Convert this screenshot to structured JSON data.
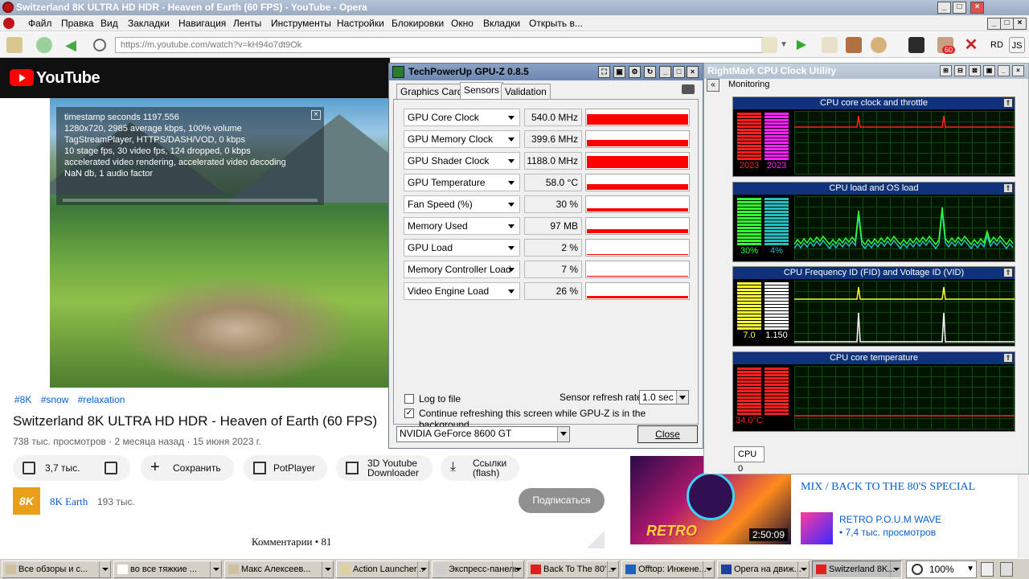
{
  "window": {
    "title": "Switzerland 8K ULTRA HD HDR - Heaven of Earth (60 FPS) - YouTube - Opera"
  },
  "menu": [
    "Файл",
    "Правка",
    "Вид",
    "Закладки",
    "Навигация",
    "Ленты",
    "Инструменты",
    "Настройки",
    "Блокировки",
    "Окно",
    "Вкладки",
    "Открыть в..."
  ],
  "address": {
    "url": "https://m.youtube.com/watch?v=kH94o7dt9Ok",
    "badge": "60",
    "btn_rd": "RD",
    "btn_js": "JS"
  },
  "youtube": {
    "logo": "YouTube",
    "stats": [
      "timestamp seconds 1197.556",
      "1280x720, 2985 average kbps, 100% volume",
      "TagStreamPlayer, HTTPS/DASH/VOD, 0 kbps",
      "10 stage fps, 30 video fps, 124 dropped, 0 kbps",
      "accelerated video rendering, accelerated video decoding",
      "NaN db, 1 audio factor"
    ],
    "tags": [
      "#8K",
      "#snow",
      "#relaxation"
    ],
    "title": "Switzerland 8K ULTRA HD HDR - Heaven of Earth (60 FPS)",
    "meta": "738 тыс. просмотров · 2 месяца назад · 15 июня 2023 г.",
    "likes": "3,7 тыс.",
    "save": "Сохранить",
    "potplayer": "PotPlayer",
    "downloader_line1": "3D Youtube",
    "downloader_line2": "Downloader",
    "links_line1": "Ссылки",
    "links_line2": "(flash)",
    "channel_logo": "8K",
    "channel_name": "8K Earth",
    "channel_subs": "193 тыс.",
    "subscribe": "Подписаться",
    "comments": "Комментарии  • 81",
    "reco_title": "MIX / BACK TO THE 80'S SPECIAL",
    "reco_duration": "2:50:09",
    "reco_thumb_text": "RETRO",
    "reco_channel": "RETRO P.O.U.M WAVE",
    "reco_views": "• 7,4 тыс. просмотров"
  },
  "gpuz": {
    "title": "TechPowerUp GPU-Z 0.8.5",
    "tabs": [
      "Graphics Card",
      "Sensors",
      "Validation"
    ],
    "active_tab": "Sensors",
    "sensors": [
      {
        "label": "GPU Core Clock",
        "value": "540.0 MHz",
        "level": 0.72
      },
      {
        "label": "GPU Memory Clock",
        "value": "399.6 MHz",
        "level": 0.45
      },
      {
        "label": "GPU Shader Clock",
        "value": "1188.0 MHz",
        "level": 0.85
      },
      {
        "label": "GPU Temperature",
        "value": "58.0 °C",
        "level": 0.4
      },
      {
        "label": "Fan Speed (%)",
        "value": "30 %",
        "level": 0.22
      },
      {
        "label": "Memory Used",
        "value": "97 MB",
        "level": 0.25
      },
      {
        "label": "GPU Load",
        "value": "2 %",
        "level": 0.03
      },
      {
        "label": "Memory Controller Load",
        "value": "7 %",
        "level": 0.05
      },
      {
        "label": "Video Engine Load",
        "value": "26 %",
        "level": 0.15
      }
    ],
    "log_to_file": "Log to file",
    "refresh_label": "Sensor refresh rate:",
    "refresh_value": "1.0 sec",
    "continue_label": "Continue refreshing this screen while GPU-Z is in the background",
    "gpu_select": "NVIDIA GeForce 8600 GT",
    "close": "Close"
  },
  "rmcu": {
    "title": "RightMark CPU Clock Utility",
    "group": "Monitoring",
    "panels": [
      {
        "title": "CPU core clock and throttle",
        "v1": "2023",
        "v2": "2023",
        "c1": "#ff2020",
        "c2": "#ff20ff"
      },
      {
        "title": "CPU load and OS load",
        "v1": "30%",
        "v2": "4%",
        "c1": "#30ff30",
        "c2": "#20c0c0"
      },
      {
        "title": "CPU Frequency ID (FID) and Voltage ID (VID)",
        "v1": "7.0",
        "v2": "1.150",
        "c1": "#ffff30",
        "c2": "#ffffff"
      },
      {
        "title": "CPU core temperature",
        "v1": "34.0°C",
        "v2": "",
        "c1": "#ff2020",
        "c2": "#ff2020"
      }
    ],
    "cpu_select": "CPU 0"
  },
  "taskbar": {
    "tasks": [
      "Все обзоры и с...",
      "во все тяжкие ...",
      "Макс Алексеев...",
      "Action Launcher...",
      "Экспресс-панель",
      "Back To The 80'...",
      "Offtop: Инжене...",
      "Opera на движ...",
      "Switzerland 8K..."
    ],
    "zoom": "100%"
  }
}
